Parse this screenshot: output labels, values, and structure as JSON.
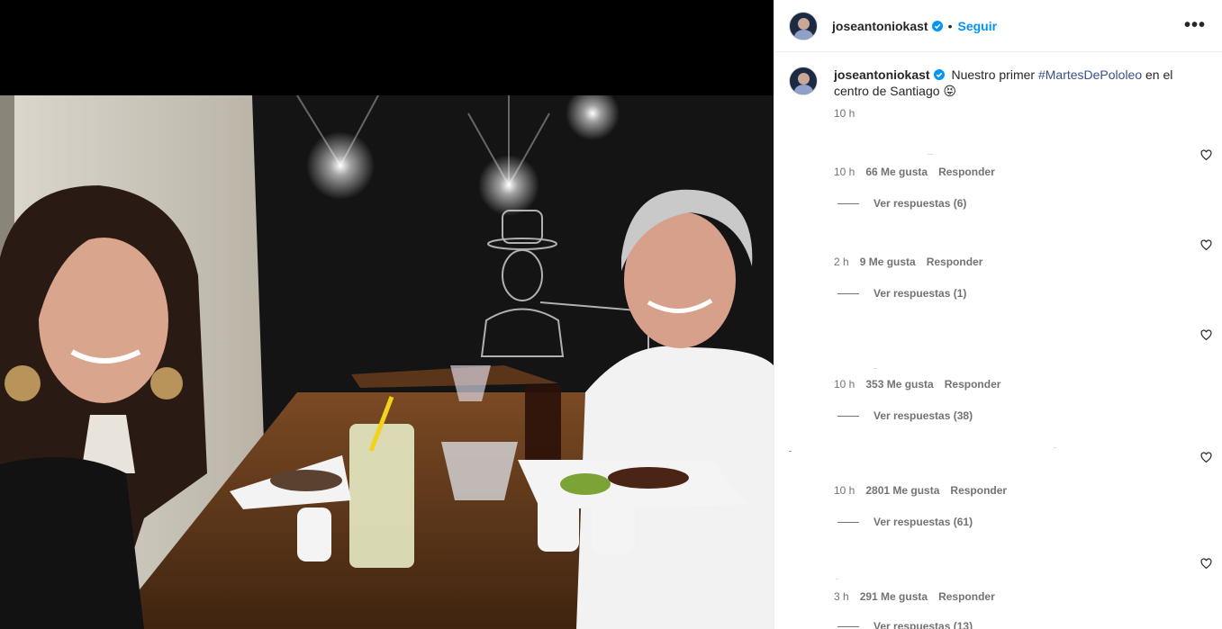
{
  "account": {
    "username": "joseantoniokast",
    "follow_label": "Seguir",
    "dot": "•",
    "more": "•••"
  },
  "caption": {
    "username": "joseantoniokast",
    "text_before": "Nuestro primer ",
    "hashtag": "#MartesDePololeo",
    "text_after": " en el centro de Santiago",
    "emoji": "😝",
    "time": "10 h"
  },
  "comments": [
    {
      "time": "10 h",
      "likes": "66 Me gusta",
      "reply": "Responder",
      "view_replies": "Ver respuestas (6)"
    },
    {
      "time": "2 h",
      "likes": "9 Me gusta",
      "reply": "Responder",
      "view_replies": "Ver respuestas (1)"
    },
    {
      "time": "10 h",
      "likes": "353 Me gusta",
      "reply": "Responder",
      "view_replies": "Ver respuestas (38)"
    },
    {
      "time": "10 h",
      "likes": "2801 Me gusta",
      "reply": "Responder",
      "view_replies": "Ver respuestas (61)"
    },
    {
      "time": "3 h",
      "likes": "291 Me gusta",
      "reply": "Responder",
      "view_replies": "Ver respuestas (13)"
    }
  ],
  "colors": {
    "follow": "#0095f6",
    "verified": "#0095f6",
    "muted": "#737373",
    "hashtag": "#385185"
  },
  "icons": {
    "verified": "verified-badge-icon",
    "heart": "heart-outline-icon",
    "more": "more-options-icon"
  }
}
